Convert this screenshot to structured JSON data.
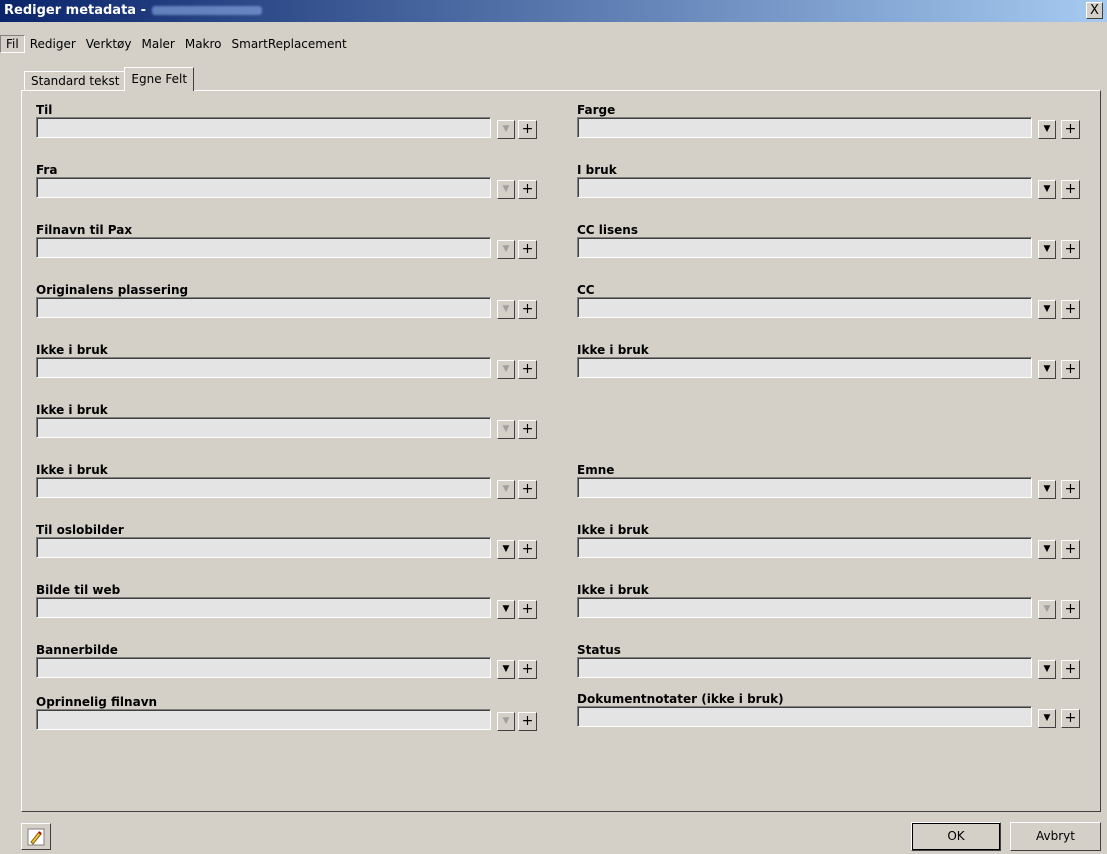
{
  "window": {
    "title": "Rediger metadata -",
    "close_glyph": "X"
  },
  "menu": [
    "Fil",
    "Rediger",
    "Verktøy",
    "Maler",
    "Makro",
    "SmartReplacement"
  ],
  "tabs": [
    {
      "label": "Standard tekst",
      "selected": false
    },
    {
      "label": "Egne Felt",
      "selected": true
    }
  ],
  "left_fields": [
    {
      "label": "Til",
      "value": "",
      "dropdown_enabled": false
    },
    {
      "label": "Fra",
      "value": "",
      "dropdown_enabled": false
    },
    {
      "label": "Filnavn til Pax",
      "value": "",
      "dropdown_enabled": false
    },
    {
      "label": "Originalens plassering",
      "value": "",
      "dropdown_enabled": false
    },
    {
      "label": "Ikke i bruk",
      "value": "",
      "dropdown_enabled": false
    },
    {
      "label": "Ikke i bruk",
      "value": "",
      "dropdown_enabled": false
    },
    {
      "label": "Ikke i bruk",
      "value": "",
      "dropdown_enabled": false
    },
    {
      "label": "Til oslobilder",
      "value": "",
      "dropdown_enabled": true
    },
    {
      "label": "Bilde til web",
      "value": "",
      "dropdown_enabled": true
    },
    {
      "label": "Bannerbilde",
      "value": "",
      "dropdown_enabled": true
    },
    {
      "label": "Oprinnelig filnavn",
      "value": "",
      "dropdown_enabled": false
    }
  ],
  "right_fields": [
    {
      "label": "Farge",
      "value": "",
      "dropdown_enabled": true
    },
    {
      "label": "I bruk",
      "value": "",
      "dropdown_enabled": true
    },
    {
      "label": "CC lisens",
      "value": "",
      "dropdown_enabled": true
    },
    {
      "label": "CC",
      "value": "",
      "dropdown_enabled": true
    },
    {
      "label": "Ikke i bruk",
      "value": "",
      "dropdown_enabled": true
    },
    {
      "label": "Emne",
      "value": "",
      "dropdown_enabled": true
    },
    {
      "label": "Ikke i bruk",
      "value": "",
      "dropdown_enabled": true
    },
    {
      "label": "Ikke i bruk",
      "value": "",
      "dropdown_enabled": false
    },
    {
      "label": "Status",
      "value": "",
      "dropdown_enabled": true
    },
    {
      "label": "Dokumentnotater (ikke i bruk)",
      "value": "",
      "dropdown_enabled": true
    }
  ],
  "buttons": {
    "ok": "OK",
    "cancel": "Avbryt",
    "edit_icon": "pencil-edit-icon",
    "dropdown_glyph": "▼",
    "plus_glyph": "+"
  }
}
